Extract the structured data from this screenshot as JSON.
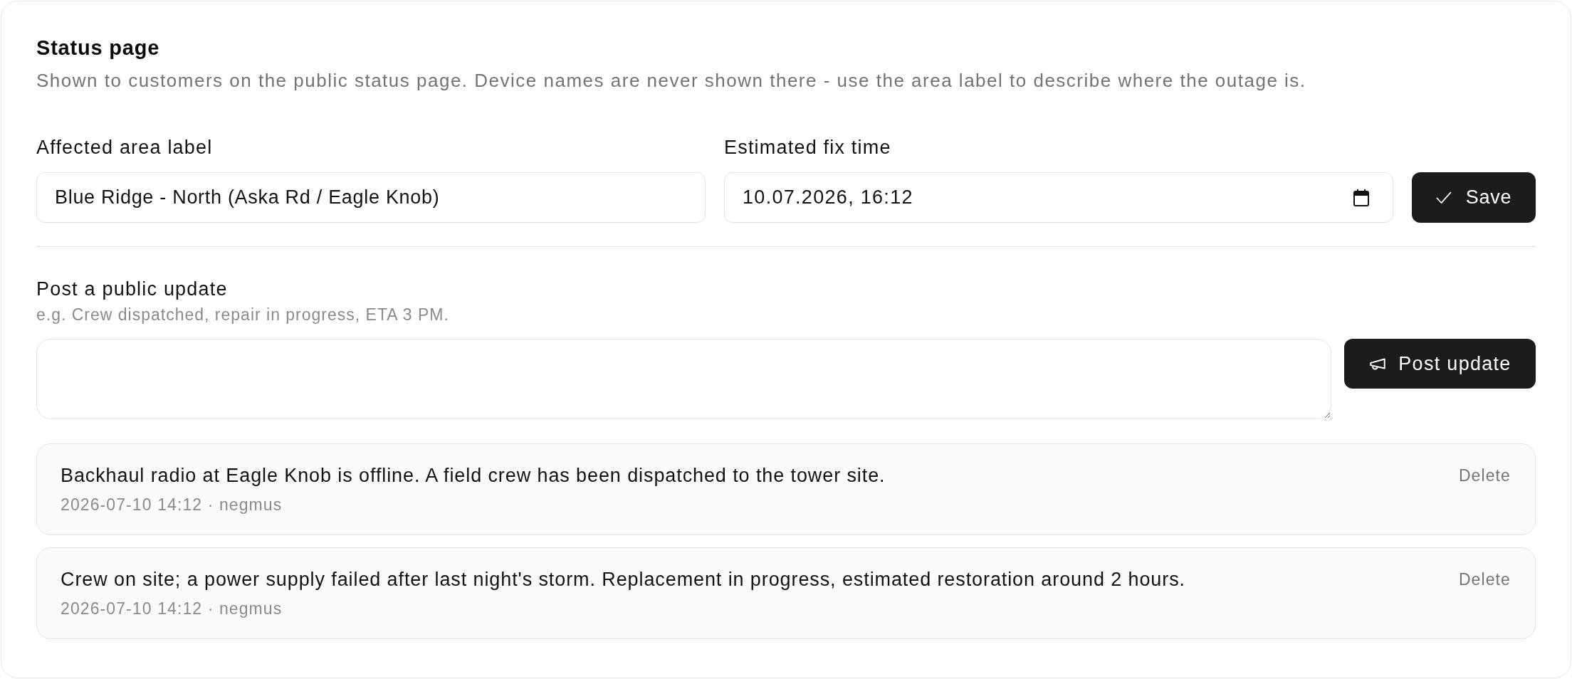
{
  "section": {
    "title": "Status page",
    "description": "Shown to customers on the public status page. Device names are never shown there - use the area label to describe where the outage is."
  },
  "fields": [
    {
      "kind": "text",
      "label": "Affected area label",
      "value": "Blue Ridge - North (Aska Rd / Eagle Knob)"
    },
    {
      "kind": "datetime",
      "label": "Estimated fix time",
      "value": "10.07.2026, 16:12"
    }
  ],
  "save_button": {
    "label": "Save"
  },
  "update_form": {
    "label": "Post a public update",
    "hint": "e.g. Crew dispatched, repair in progress, ETA 3 PM.",
    "button": "Post update"
  },
  "updates": [
    {
      "text": "Backhaul radio at Eagle Knob is offline. A field crew has been dispatched to the tower site.",
      "meta": "2026-07-10 14:12 · negmus",
      "action": "Delete"
    },
    {
      "text": "Crew on site; a power supply failed after last night's storm. Replacement in progress, estimated restoration around 2 hours.",
      "meta": "2026-07-10 14:12 · negmus",
      "action": "Delete"
    }
  ]
}
